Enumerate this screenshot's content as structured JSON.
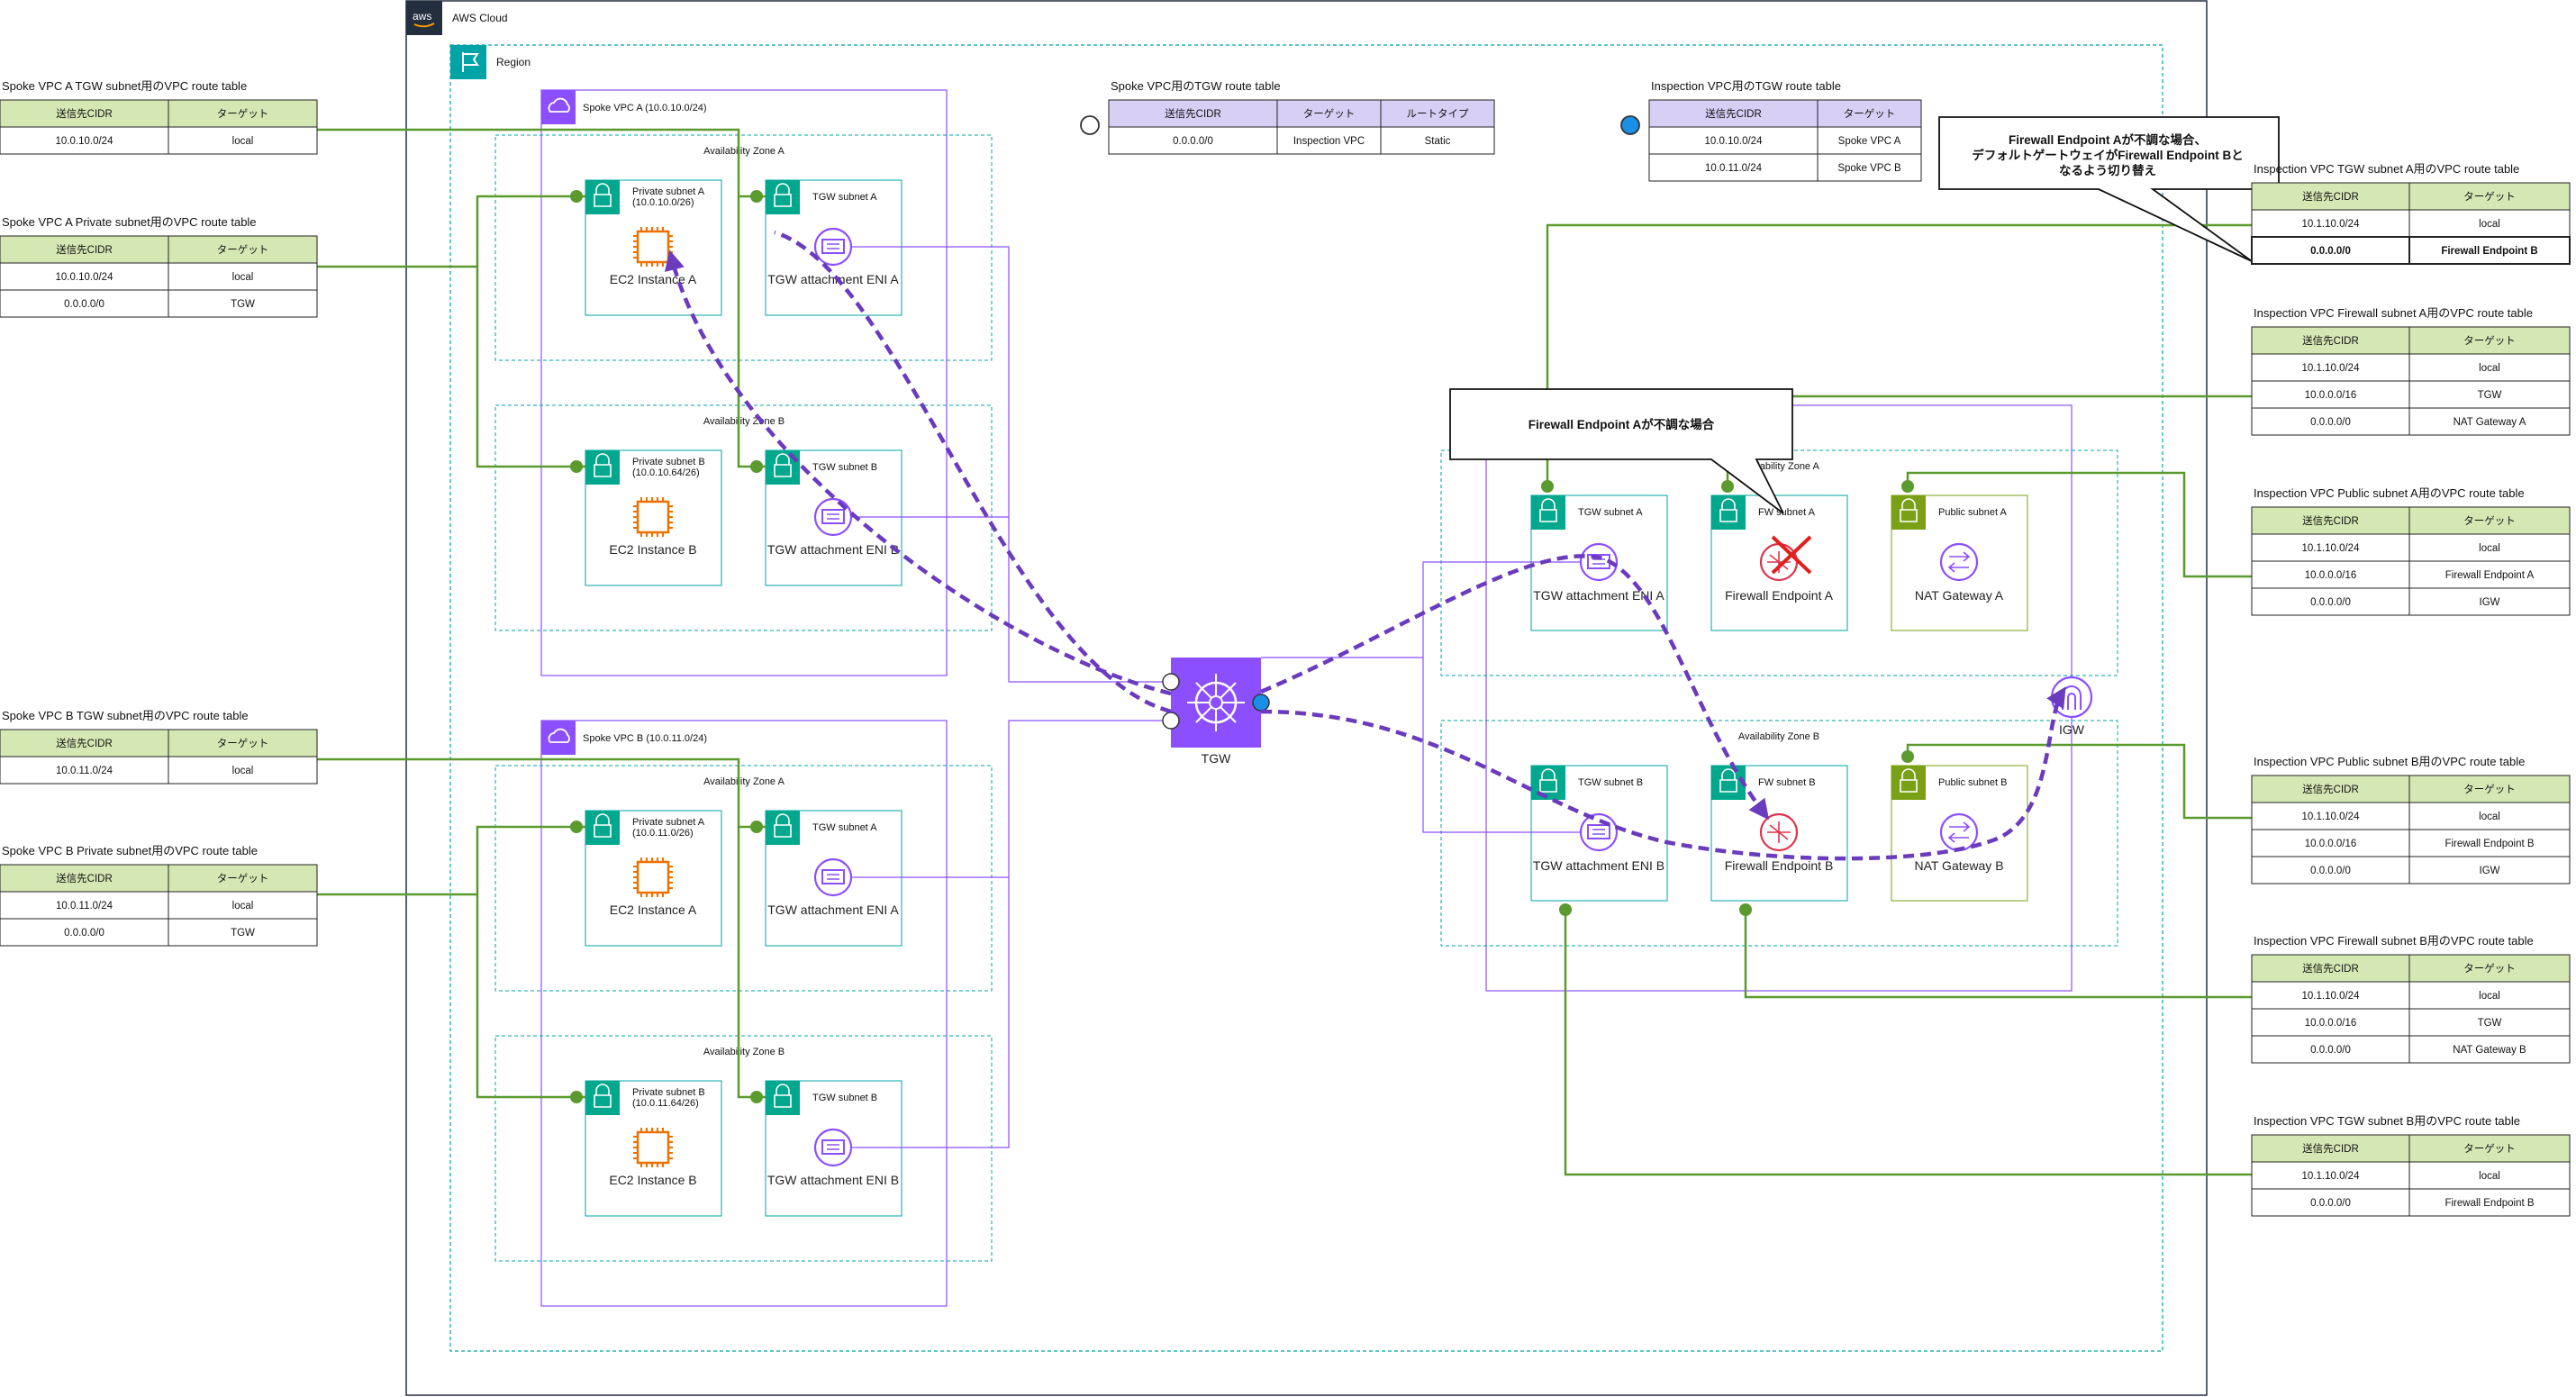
{
  "cloud": {
    "label": "AWS Cloud",
    "logo": "aws"
  },
  "region": {
    "label": "Region"
  },
  "spoke_a": {
    "label": "Spoke VPC A (10.0.10.0/24)",
    "az_a": "Availability Zone A",
    "az_b": "Availability Zone B",
    "priv_a": [
      "Private subnet A",
      "(10.0.10.0/26)"
    ],
    "priv_b": [
      "Private subnet B",
      "(10.0.10.64/26)"
    ],
    "tgw_a": "TGW subnet A",
    "tgw_b": "TGW subnet B",
    "ec2_a": "EC2 Instance A",
    "ec2_b": "EC2 Instance B",
    "eni_a": "TGW attachment ENI A",
    "eni_b": "TGW attachment ENI B"
  },
  "spoke_b": {
    "label": "Spoke VPC B (10.0.11.0/24)",
    "az_a": "Availability Zone A",
    "az_b": "Availability Zone B",
    "priv_a": [
      "Private subnet A",
      "(10.0.11.0/26)"
    ],
    "priv_b": [
      "Private subnet B",
      "(10.0.11.64/26)"
    ],
    "tgw_a": "TGW subnet A",
    "tgw_b": "TGW subnet B",
    "ec2_a": "EC2 Instance A",
    "ec2_b": "EC2 Instance B",
    "eni_a": "TGW attachment ENI A",
    "eni_b": "TGW attachment ENI B"
  },
  "tgw": {
    "label": "TGW"
  },
  "inspection": {
    "az_a": "Availability Zone A",
    "az_b": "Availability Zone B",
    "tgw_a": "TGW subnet A",
    "tgw_b": "TGW subnet B",
    "fw_a": "FW subnet A",
    "fw_b": "FW subnet B",
    "pub_a": "Public subnet A",
    "pub_b": "Public subnet B",
    "eni_a": "TGW attachment ENI A",
    "eni_b": "TGW attachment ENI B",
    "fwe_a": "Firewall Endpoint A",
    "fwe_b": "Firewall Endpoint B",
    "nat_a": "NAT Gateway A",
    "nat_b": "NAT Gateway B",
    "igw": "IGW"
  },
  "callouts": {
    "top": [
      "Firewall Endpoint Aが不調な場合、",
      "デフォルトゲートウェイがFirewall Endpoint Bと",
      "なるよう切り替え"
    ],
    "mid": "Firewall Endpoint Aが不調な場合"
  },
  "headers": {
    "cidr": "送信先CIDR",
    "target": "ターゲット",
    "route_type": "ルートタイプ"
  },
  "tables": {
    "t1": {
      "title": "Spoke VPC A TGW subnet用のVPC route table",
      "rows": [
        [
          "10.0.10.0/24",
          "local"
        ]
      ]
    },
    "t2": {
      "title": "Spoke VPC A Private subnet用のVPC route table",
      "rows": [
        [
          "10.0.10.0/24",
          "local"
        ],
        [
          "0.0.0.0/0",
          "TGW"
        ]
      ]
    },
    "t3": {
      "title": "Spoke VPC B TGW subnet用のVPC route table",
      "rows": [
        [
          "10.0.11.0/24",
          "local"
        ]
      ]
    },
    "t4": {
      "title": "Spoke VPC B Private subnet用のVPC route table",
      "rows": [
        [
          "10.0.11.0/24",
          "local"
        ],
        [
          "0.0.0.0/0",
          "TGW"
        ]
      ]
    },
    "t5": {
      "title": "Spoke VPC用のTGW route table",
      "rows": [
        [
          "0.0.0.0/0",
          "Inspection VPC",
          "Static"
        ]
      ]
    },
    "t6": {
      "title": "Inspection VPC用のTGW route table",
      "rows": [
        [
          "10.0.10.0/24",
          "Spoke VPC A"
        ],
        [
          "10.0.11.0/24",
          "Spoke VPC B"
        ]
      ]
    },
    "t7": {
      "title": "Inspection VPC TGW subnet A用のVPC route table",
      "rows": [
        [
          "10.1.10.0/24",
          "local"
        ],
        [
          "0.0.0.0/0",
          "Firewall Endpoint B"
        ]
      ]
    },
    "t8": {
      "title": "Inspection VPC Firewall subnet A用のVPC route table",
      "rows": [
        [
          "10.1.10.0/24",
          "local"
        ],
        [
          "10.0.0.0/16",
          "TGW"
        ],
        [
          "0.0.0.0/0",
          "NAT Gateway A"
        ]
      ]
    },
    "t9": {
      "title": "Inspection VPC Public subnet A用のVPC route table",
      "rows": [
        [
          "10.1.10.0/24",
          "local"
        ],
        [
          "10.0.0.0/16",
          "Firewall Endpoint A"
        ],
        [
          "0.0.0.0/0",
          "IGW"
        ]
      ]
    },
    "t10": {
      "title": "Inspection VPC Public subnet B用のVPC route table",
      "rows": [
        [
          "10.1.10.0/24",
          "local"
        ],
        [
          "10.0.0.0/16",
          "Firewall Endpoint B"
        ],
        [
          "0.0.0.0/0",
          "IGW"
        ]
      ]
    },
    "t11": {
      "title": "Inspection VPC Firewall subnet B用のVPC route table",
      "rows": [
        [
          "10.1.10.0/24",
          "local"
        ],
        [
          "10.0.0.0/16",
          "TGW"
        ],
        [
          "0.0.0.0/0",
          "NAT Gateway B"
        ]
      ]
    },
    "t12": {
      "title": "Inspection VPC TGW subnet B用のVPC route table",
      "rows": [
        [
          "10.1.10.0/24",
          "local"
        ],
        [
          "0.0.0.0/0",
          "Firewall Endpoint B"
        ]
      ]
    }
  },
  "colors": {
    "green": "#5b9a2e",
    "purple": "#8c4fff",
    "teal": "#00a4a6",
    "teal_dark": "#01a88d",
    "orange": "#ed7100",
    "red": "#dd344c",
    "path": "#6a3bbd",
    "header_green": "#d5e8b4",
    "header_purple": "#d8cff5",
    "nat_green": "#7aa116"
  }
}
